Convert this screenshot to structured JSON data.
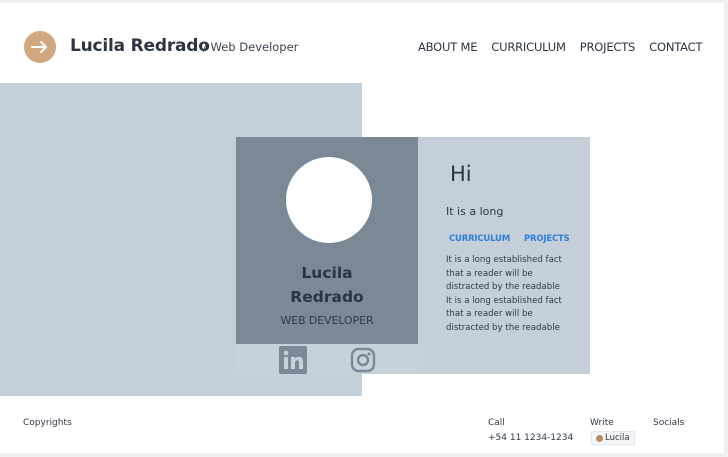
{
  "header": {
    "name": "Lucila Redrado",
    "role": "/ Web Developer",
    "nav": [
      "ABOUT ME",
      "CURRICULUM",
      "PROJECTS",
      "CONTACT"
    ]
  },
  "profile": {
    "first_name": "Lucila",
    "last_name": "Redrado",
    "role": "WEB DEVELOPER"
  },
  "socials": [
    "linkedin-icon",
    "instagram-icon"
  ],
  "info": {
    "title": "Hi",
    "subtitle": "It is a long",
    "links": [
      "CURRICULUM",
      "PROJECTS"
    ],
    "body": "It is a long established fact that a reader will be distracted by the readable It is a long established fact that a reader will be distracted by the readable"
  },
  "footer": {
    "copyright": "Copyrights",
    "call_label": "Call",
    "call_value": "+54 11 1234-1234",
    "write_label": "Write",
    "write_value": "Lucila",
    "socials_label": "Socials"
  },
  "colors": {
    "accent": "#d2a67f",
    "hero_bg": "#c4cfd9",
    "card_bg": "#7b8996",
    "link": "#2f80d8"
  }
}
